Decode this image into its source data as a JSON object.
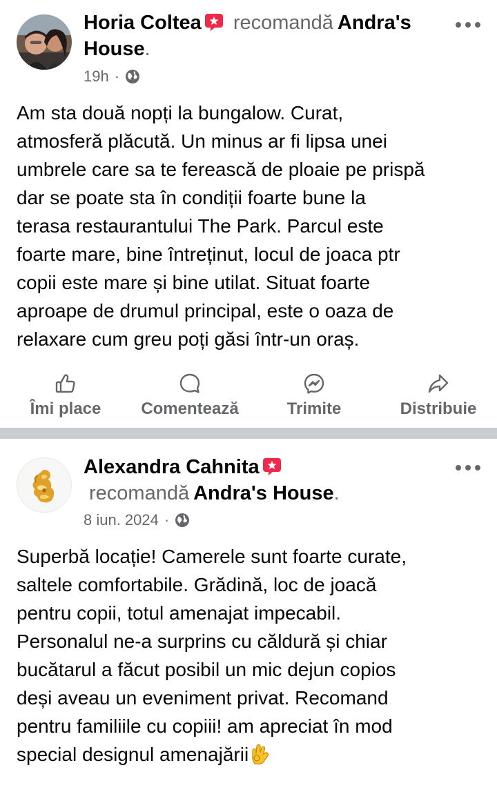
{
  "posts": [
    {
      "author": "Horia Coltea",
      "verb": "recomandă",
      "page": "Andra's House",
      "time": "19h",
      "audience_icon": "globe-icon",
      "text": "Am sta două nopți la bungalow. Curat,\natmosferă plăcută. Un minus ar fi lipsa unei\numbrele care sa te ferească de ploaie pe prispă\ndar se poate sta în condiții foarte bune la\nterasa restaurantului The Park. Parcul este\nfoarte mare, bine întreținut, locul de joaca ptr\ncopii este mare și bine utilat. Situat foarte\naproape de drumul principal, este o oaza de\nrelaxare cum greu poți găsi într-un oraș."
    },
    {
      "author": "Alexandra Cahnita",
      "verb": "recomandă",
      "page": "Andra's House",
      "time": "8 iun. 2024",
      "audience_icon": "globe-icon",
      "text": "Superbă locație! Camerele sunt foarte curate,\nsaltele comfortabile. Grădină, loc de joacă\npentru copii, totul amenajat impecabil.\nPersonalul ne-a surprins cu căldură și chiar\nbucătarul a făcut posibil un mic dejun copios\ndeși aveau un eveniment privat. Recomand\npentru familiile cu copiii! am apreciat în mod\nspecial designul amenajării",
      "text_emoji": "ok-hand-emoji"
    }
  ],
  "actions": {
    "like": "Îmi place",
    "comment": "Comentează",
    "send": "Trimite",
    "share": "Distribuie"
  },
  "colors": {
    "primary_text": "#050505",
    "secondary_text": "#65676b",
    "separator": "#c9ccd1",
    "recommend_badge": "#f02849"
  }
}
